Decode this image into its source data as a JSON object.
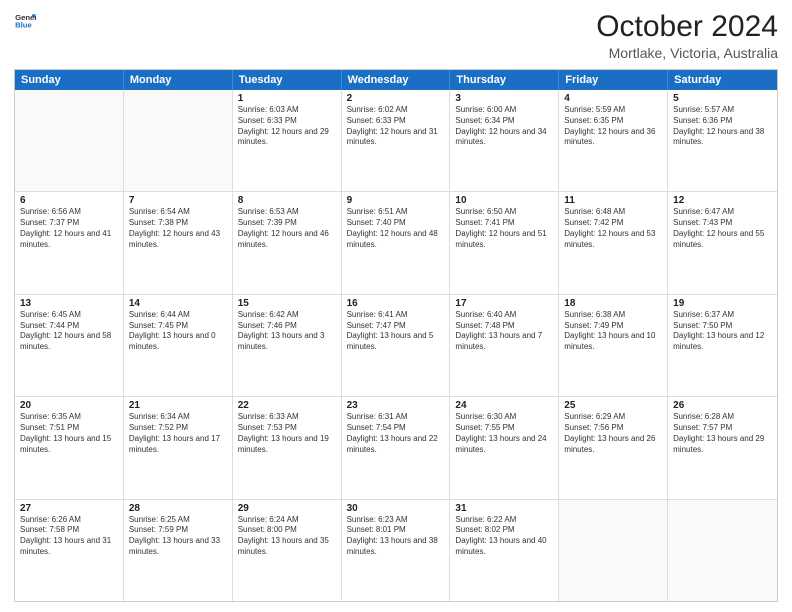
{
  "header": {
    "logo_line1": "General",
    "logo_line2": "Blue",
    "title": "October 2024",
    "subtitle": "Mortlake, Victoria, Australia"
  },
  "days_of_week": [
    "Sunday",
    "Monday",
    "Tuesday",
    "Wednesday",
    "Thursday",
    "Friday",
    "Saturday"
  ],
  "weeks": [
    [
      {
        "day": "",
        "info": ""
      },
      {
        "day": "",
        "info": ""
      },
      {
        "day": "1",
        "info": "Sunrise: 6:03 AM\nSunset: 6:33 PM\nDaylight: 12 hours and 29 minutes."
      },
      {
        "day": "2",
        "info": "Sunrise: 6:02 AM\nSunset: 6:33 PM\nDaylight: 12 hours and 31 minutes."
      },
      {
        "day": "3",
        "info": "Sunrise: 6:00 AM\nSunset: 6:34 PM\nDaylight: 12 hours and 34 minutes."
      },
      {
        "day": "4",
        "info": "Sunrise: 5:59 AM\nSunset: 6:35 PM\nDaylight: 12 hours and 36 minutes."
      },
      {
        "day": "5",
        "info": "Sunrise: 5:57 AM\nSunset: 6:36 PM\nDaylight: 12 hours and 38 minutes."
      }
    ],
    [
      {
        "day": "6",
        "info": "Sunrise: 6:56 AM\nSunset: 7:37 PM\nDaylight: 12 hours and 41 minutes."
      },
      {
        "day": "7",
        "info": "Sunrise: 6:54 AM\nSunset: 7:38 PM\nDaylight: 12 hours and 43 minutes."
      },
      {
        "day": "8",
        "info": "Sunrise: 6:53 AM\nSunset: 7:39 PM\nDaylight: 12 hours and 46 minutes."
      },
      {
        "day": "9",
        "info": "Sunrise: 6:51 AM\nSunset: 7:40 PM\nDaylight: 12 hours and 48 minutes."
      },
      {
        "day": "10",
        "info": "Sunrise: 6:50 AM\nSunset: 7:41 PM\nDaylight: 12 hours and 51 minutes."
      },
      {
        "day": "11",
        "info": "Sunrise: 6:48 AM\nSunset: 7:42 PM\nDaylight: 12 hours and 53 minutes."
      },
      {
        "day": "12",
        "info": "Sunrise: 6:47 AM\nSunset: 7:43 PM\nDaylight: 12 hours and 55 minutes."
      }
    ],
    [
      {
        "day": "13",
        "info": "Sunrise: 6:45 AM\nSunset: 7:44 PM\nDaylight: 12 hours and 58 minutes."
      },
      {
        "day": "14",
        "info": "Sunrise: 6:44 AM\nSunset: 7:45 PM\nDaylight: 13 hours and 0 minutes."
      },
      {
        "day": "15",
        "info": "Sunrise: 6:42 AM\nSunset: 7:46 PM\nDaylight: 13 hours and 3 minutes."
      },
      {
        "day": "16",
        "info": "Sunrise: 6:41 AM\nSunset: 7:47 PM\nDaylight: 13 hours and 5 minutes."
      },
      {
        "day": "17",
        "info": "Sunrise: 6:40 AM\nSunset: 7:48 PM\nDaylight: 13 hours and 7 minutes."
      },
      {
        "day": "18",
        "info": "Sunrise: 6:38 AM\nSunset: 7:49 PM\nDaylight: 13 hours and 10 minutes."
      },
      {
        "day": "19",
        "info": "Sunrise: 6:37 AM\nSunset: 7:50 PM\nDaylight: 13 hours and 12 minutes."
      }
    ],
    [
      {
        "day": "20",
        "info": "Sunrise: 6:35 AM\nSunset: 7:51 PM\nDaylight: 13 hours and 15 minutes."
      },
      {
        "day": "21",
        "info": "Sunrise: 6:34 AM\nSunset: 7:52 PM\nDaylight: 13 hours and 17 minutes."
      },
      {
        "day": "22",
        "info": "Sunrise: 6:33 AM\nSunset: 7:53 PM\nDaylight: 13 hours and 19 minutes."
      },
      {
        "day": "23",
        "info": "Sunrise: 6:31 AM\nSunset: 7:54 PM\nDaylight: 13 hours and 22 minutes."
      },
      {
        "day": "24",
        "info": "Sunrise: 6:30 AM\nSunset: 7:55 PM\nDaylight: 13 hours and 24 minutes."
      },
      {
        "day": "25",
        "info": "Sunrise: 6:29 AM\nSunset: 7:56 PM\nDaylight: 13 hours and 26 minutes."
      },
      {
        "day": "26",
        "info": "Sunrise: 6:28 AM\nSunset: 7:57 PM\nDaylight: 13 hours and 29 minutes."
      }
    ],
    [
      {
        "day": "27",
        "info": "Sunrise: 6:26 AM\nSunset: 7:58 PM\nDaylight: 13 hours and 31 minutes."
      },
      {
        "day": "28",
        "info": "Sunrise: 6:25 AM\nSunset: 7:59 PM\nDaylight: 13 hours and 33 minutes."
      },
      {
        "day": "29",
        "info": "Sunrise: 6:24 AM\nSunset: 8:00 PM\nDaylight: 13 hours and 35 minutes."
      },
      {
        "day": "30",
        "info": "Sunrise: 6:23 AM\nSunset: 8:01 PM\nDaylight: 13 hours and 38 minutes."
      },
      {
        "day": "31",
        "info": "Sunrise: 6:22 AM\nSunset: 8:02 PM\nDaylight: 13 hours and 40 minutes."
      },
      {
        "day": "",
        "info": ""
      },
      {
        "day": "",
        "info": ""
      }
    ]
  ]
}
